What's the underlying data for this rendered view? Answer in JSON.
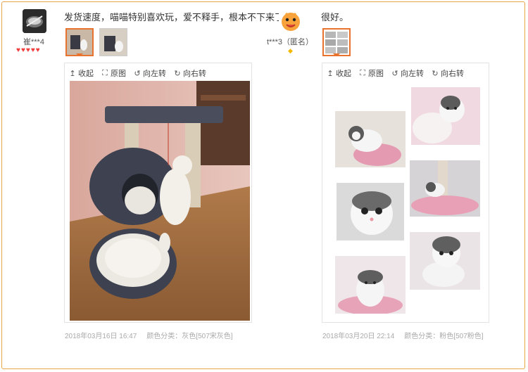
{
  "reviews": [
    {
      "username": "崔***4",
      "text": "发货速度，喵喵特别喜欢玩，爱不释手，根本不下来了",
      "toolbar": {
        "collapse": "收起",
        "original": "原图",
        "rotate_left": "向左转",
        "rotate_right": "向右转"
      },
      "date": "2018年03月16日 16:47",
      "sku_label": "颜色分类：灰色[507宋灰色]",
      "hearts": 5
    },
    {
      "username": "t***3（匿名）",
      "text": "很好。",
      "toolbar": {
        "collapse": "收起",
        "original": "原图",
        "rotate_left": "向左转",
        "rotate_right": "向右转"
      },
      "date": "2018年03月20日 22:14",
      "sku_label": "颜色分类：粉色[507粉色]",
      "hearts": 0
    }
  ],
  "icons": {
    "collapse": "collapse-arrow-icon",
    "original": "fullscreen-icon",
    "rotate_left": "rotate-left-icon",
    "rotate_right": "rotate-right-icon",
    "heart": "heart-icon"
  },
  "colors": {
    "frame": "#e8a646",
    "active_thumb": "#e8732e",
    "heart": "#f03c3c",
    "meta": "#aaaaaa"
  }
}
